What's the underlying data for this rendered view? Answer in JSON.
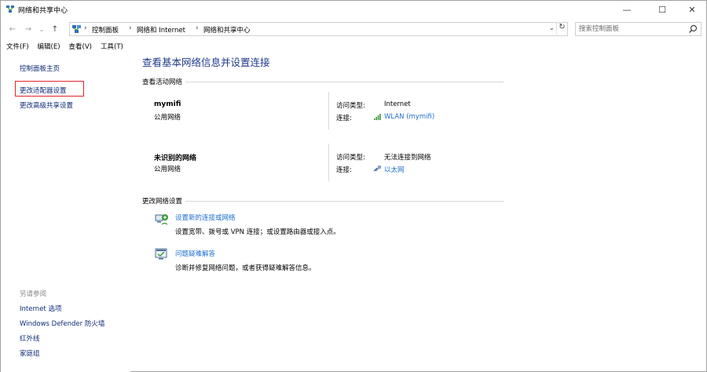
{
  "window": {
    "title": "网络和共享中心",
    "controls": {
      "minimize": "—",
      "maximize": "☐",
      "close": "✕"
    }
  },
  "nav": {
    "back": "←",
    "forward": "→",
    "recent": "⌄",
    "up": "↑",
    "breadcrumbs": [
      "控制面板",
      "网络和 Internet",
      "网络和共享中心"
    ],
    "separator": "›",
    "dropdown": "⌄",
    "refresh": "↻",
    "search_placeholder": "搜索控制面板"
  },
  "menu": {
    "items": [
      "文件(F)",
      "编辑(E)",
      "查看(V)",
      "工具(T)"
    ]
  },
  "sidebar": {
    "home": "控制面板主页",
    "links": [
      "更改适配器设置",
      "更改高级共享设置"
    ],
    "see_also_heading": "另请参阅",
    "see_also": [
      "Internet 选项",
      "Windows Defender 防火墙",
      "红外线",
      "家庭组"
    ]
  },
  "main": {
    "title": "查看基本网络信息并设置连接",
    "active_networks_heading": "查看活动网络",
    "networks": [
      {
        "name": "mymifi",
        "type": "公用网络",
        "access_label": "访问类型:",
        "access_value": "Internet",
        "conn_label": "连接:",
        "conn_value": "WLAN (mymifi)",
        "conn_icon": "wifi-signal-icon"
      },
      {
        "name": "未识别的网络",
        "type": "公用网络",
        "access_label": "访问类型:",
        "access_value": "无法连接到网络",
        "conn_label": "连接:",
        "conn_value": "以太网",
        "conn_icon": "ethernet-icon"
      }
    ],
    "change_settings_heading": "更改网络设置",
    "tasks": [
      {
        "link": "设置新的连接或网络",
        "desc": "设置宽带、拨号或 VPN 连接；或设置路由器或接入点。",
        "icon": "new-connection-icon"
      },
      {
        "link": "问题疑难解答",
        "desc": "诊断并修复网络问题，或者获得疑难解答信息。",
        "icon": "troubleshoot-icon"
      }
    ]
  },
  "colors": {
    "link": "#1e6fd0",
    "sidebar_link": "#1e3a8a",
    "title": "#1e3a8a",
    "highlight": "#e3252b"
  }
}
